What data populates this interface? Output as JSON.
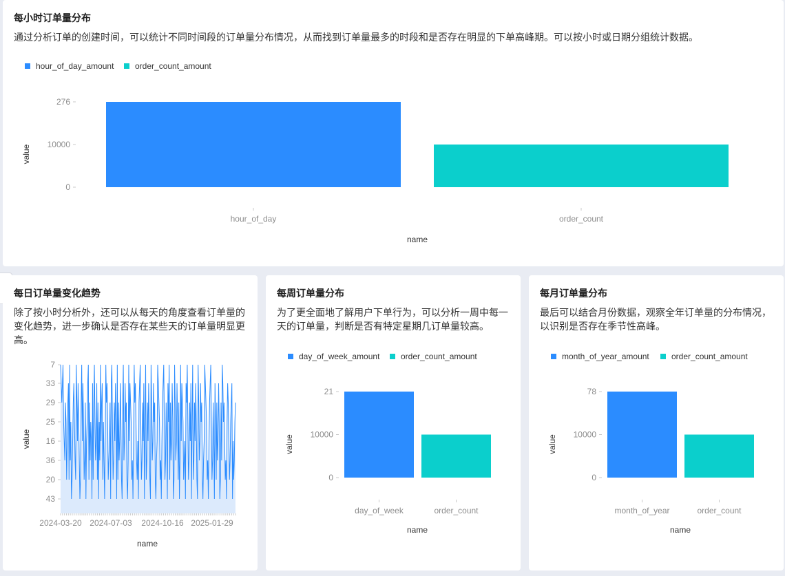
{
  "colors": {
    "series1": "#2b8cff",
    "series2": "#0bcfcc",
    "area": "#dceafc",
    "axis": "#c8c8c8",
    "tick": "#8c8c8c"
  },
  "icons": {
    "collapse": "caret-right-icon"
  },
  "cards": {
    "hour": {
      "title": "每小时订单量分布",
      "desc": "通过分析订单的创建时间，可以统计不同时间段的订单量分布情况，从而找到订单量最多的时段和是否存在明显的下单高峰期。可以按小时或日期分组统计数据。"
    },
    "day": {
      "title": "每日订单量变化趋势",
      "desc": "除了按小时分析外，还可以从每天的角度查看订单量的变化趋势，进一步确认是否存在某些天的订单量明显更高。"
    },
    "week": {
      "title": "每周订单量分布",
      "desc": "为了更全面地了解用户下单行为，可以分析一周中每一天的订单量，判断是否有特定星期几订单量较高。"
    },
    "month": {
      "title": "每月订单量分布",
      "desc": "最后可以结合月份数据，观察全年订单量的分布情况，以识别是否存在季节性高峰。"
    }
  },
  "chart_data": [
    {
      "type": "bar",
      "categories": [
        "hour_of_day",
        "order_count"
      ],
      "values": [
        276,
        10000
      ],
      "legend": [
        "hour_of_day_amount",
        "order_count_amount"
      ],
      "xlabel": "name",
      "ylabel": "value",
      "yticks": [
        "0",
        "10000",
        "276"
      ],
      "legend_position": "top-left",
      "grid": false
    },
    {
      "type": "area",
      "xlabel": "name",
      "ylabel": "value",
      "xticks": [
        "2024-03-20",
        "2024-07-03",
        "2024-10-16",
        "2025-01-29"
      ],
      "yticks": [
        "7",
        "33",
        "29",
        "25",
        "16",
        "36",
        "20",
        "43"
      ],
      "values": [
        7,
        33,
        29,
        33,
        7,
        25,
        16,
        36,
        29,
        25,
        20,
        16,
        29,
        33,
        20,
        7,
        36,
        25,
        43,
        20,
        16,
        29,
        33,
        25,
        36,
        20,
        7,
        29,
        16,
        33,
        25,
        36,
        43,
        20,
        29,
        7,
        16,
        33,
        25,
        20,
        36,
        29,
        43,
        16,
        25,
        33,
        7,
        20,
        29,
        36,
        25,
        16,
        43,
        33,
        20,
        29,
        7,
        25,
        36,
        16,
        33,
        20,
        29,
        43,
        25,
        36,
        7,
        16,
        29,
        33,
        20,
        25,
        36,
        43,
        16,
        7,
        29,
        33,
        25,
        20,
        36,
        16,
        29,
        43,
        33,
        7,
        25,
        20,
        36,
        29,
        16,
        33,
        25,
        43,
        7,
        20,
        29,
        36,
        16,
        33,
        25,
        20,
        43,
        29,
        7,
        36,
        16,
        33,
        25,
        29,
        20,
        43,
        36,
        7,
        16,
        33,
        29,
        25,
        20,
        36,
        43,
        16,
        7,
        29,
        33,
        25,
        36,
        20,
        16,
        43,
        29,
        33,
        7,
        25,
        20,
        36,
        29,
        16,
        33,
        43,
        25,
        7,
        20,
        36,
        29,
        16,
        33,
        25,
        20,
        43,
        7,
        29,
        36,
        16,
        33,
        25,
        29,
        20,
        43,
        36,
        16,
        7,
        33,
        29,
        25,
        20,
        36,
        43,
        16,
        29,
        33,
        7,
        25,
        20,
        36,
        29,
        16,
        43,
        33,
        25,
        7,
        20,
        29,
        36,
        16,
        33,
        25,
        43,
        20,
        7,
        29,
        36,
        16,
        33,
        25,
        20,
        29,
        43,
        36,
        7,
        16,
        33,
        29,
        25,
        20,
        36,
        16,
        43,
        33,
        29,
        7,
        25,
        20,
        36,
        29,
        16,
        33,
        43,
        25,
        7,
        20,
        36,
        29,
        16,
        33,
        25,
        20,
        43,
        7,
        29,
        36,
        16,
        33,
        25,
        29,
        20,
        43,
        36,
        16,
        7,
        33,
        29,
        25,
        20,
        36,
        43,
        16,
        29,
        33,
        7,
        25,
        20,
        36,
        29,
        16,
        43,
        33,
        25,
        20,
        29,
        36,
        16,
        33,
        25,
        43,
        20,
        29,
        36,
        7,
        33,
        25,
        29,
        16,
        20,
        36,
        43,
        25,
        33,
        29,
        16,
        20,
        36,
        25,
        29,
        33,
        43,
        16,
        20,
        36,
        25,
        29
      ]
    },
    {
      "type": "bar",
      "categories": [
        "day_of_week",
        "order_count"
      ],
      "values": [
        21,
        10000
      ],
      "legend": [
        "day_of_week_amount",
        "order_count_amount"
      ],
      "xlabel": "name",
      "ylabel": "value",
      "yticks": [
        "0",
        "10000",
        "21"
      ],
      "legend_position": "top-left",
      "grid": false
    },
    {
      "type": "bar",
      "categories": [
        "month_of_year",
        "order_count"
      ],
      "values": [
        78,
        10000
      ],
      "legend": [
        "month_of_year_amount",
        "order_count_amount"
      ],
      "xlabel": "name",
      "ylabel": "value",
      "yticks": [
        "0",
        "10000",
        "78"
      ],
      "legend_position": "top-left",
      "grid": false
    }
  ]
}
